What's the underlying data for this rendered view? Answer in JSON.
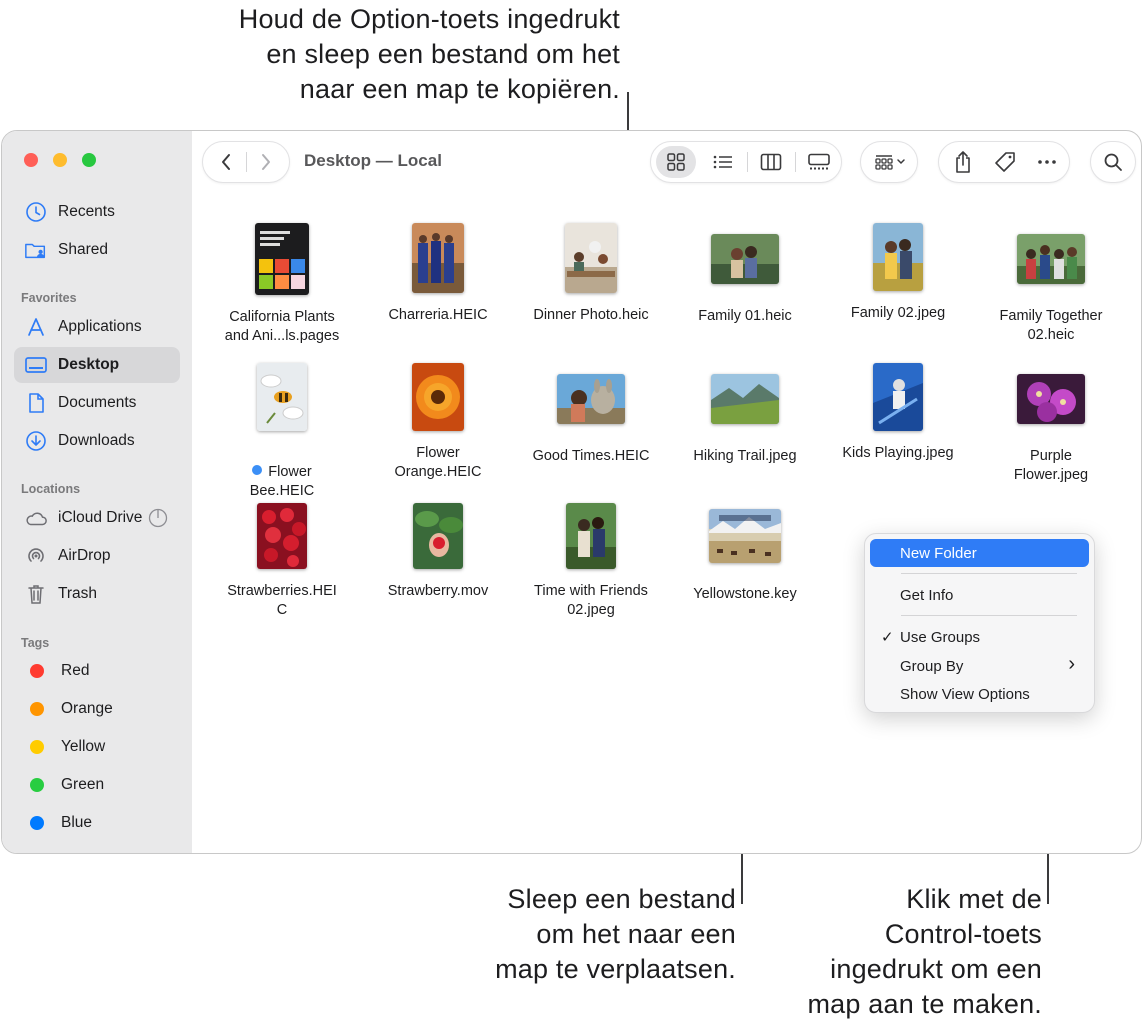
{
  "callouts": {
    "option_drag": "Houd de Option-toets ingedrukt\nen sleep een bestand om het\nnaar een map te kopiëren.",
    "drag_move": "Sleep een bestand\nom het naar een\nmap te verplaatsen.",
    "control_click": "Klik met de\nControl-toets\ningedrukt om een\nmap aan te maken."
  },
  "window": {
    "title": "Desktop — Local",
    "colors": {
      "close": "#ff5f57",
      "minimize": "#febc2e",
      "zoom": "#28c840",
      "accent": "#2f7cf6"
    }
  },
  "sidebar": {
    "top_items": [
      {
        "label": "Recents",
        "icon": "clock-icon"
      },
      {
        "label": "Shared",
        "icon": "shared-folder-icon"
      }
    ],
    "favorites_header": "Favorites",
    "favorites": [
      {
        "label": "Applications",
        "icon": "applications-icon"
      },
      {
        "label": "Desktop",
        "icon": "desktop-icon",
        "selected": true
      },
      {
        "label": "Documents",
        "icon": "document-icon"
      },
      {
        "label": "Downloads",
        "icon": "download-icon"
      }
    ],
    "locations_header": "Locations",
    "locations": [
      {
        "label": "iCloud Drive",
        "icon": "cloud-icon"
      },
      {
        "label": "AirDrop",
        "icon": "airdrop-icon"
      },
      {
        "label": "Trash",
        "icon": "trash-icon"
      }
    ],
    "tags_header": "Tags",
    "tags": [
      {
        "label": "Red",
        "color": "#ff3b30"
      },
      {
        "label": "Orange",
        "color": "#ff9500"
      },
      {
        "label": "Yellow",
        "color": "#ffcc00"
      },
      {
        "label": "Green",
        "color": "#28cd41"
      },
      {
        "label": "Blue",
        "color": "#007aff"
      }
    ]
  },
  "files": [
    {
      "name": "California Plants\nand Ani...ls.pages"
    },
    {
      "name": "Charreria.HEIC"
    },
    {
      "name": "Dinner Photo.heic"
    },
    {
      "name": "Family 01.heic"
    },
    {
      "name": "Family 02.jpeg"
    },
    {
      "name": "Family Together\n02.heic"
    },
    {
      "name": "Flower\nBee.HEIC",
      "tag": "#3b8ff6"
    },
    {
      "name": "Flower\nOrange.HEIC"
    },
    {
      "name": "Good Times.HEIC"
    },
    {
      "name": "Hiking Trail.jpeg"
    },
    {
      "name": "Kids Playing.jpeg"
    },
    {
      "name": "Purple\nFlower.jpeg"
    },
    {
      "name": "Strawberries.HEI\nC"
    },
    {
      "name": "Strawberry.mov"
    },
    {
      "name": "Time with Friends\n02.jpeg"
    },
    {
      "name": "Yellowstone.key"
    }
  ],
  "context_menu": {
    "new_folder": "New Folder",
    "get_info": "Get Info",
    "use_groups": "Use Groups",
    "use_groups_check": "✓",
    "group_by": "Group By",
    "group_by_arrow": "›",
    "show_view_options": "Show View Options"
  }
}
